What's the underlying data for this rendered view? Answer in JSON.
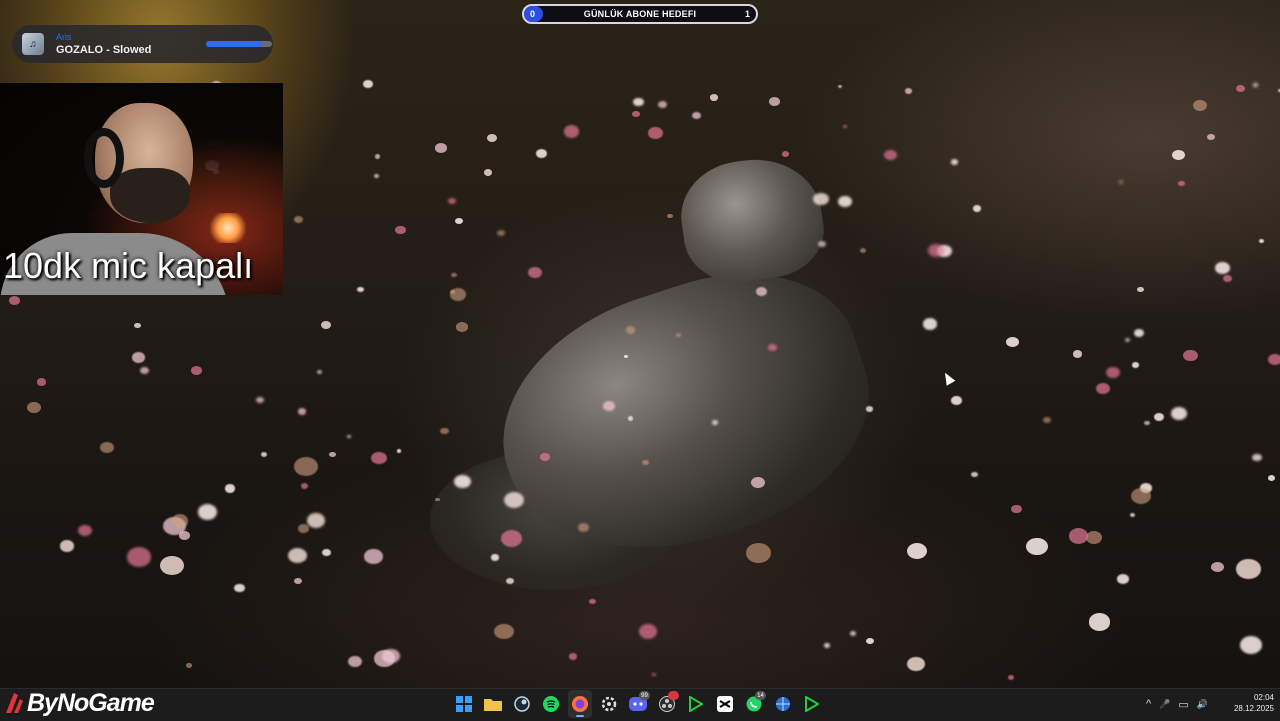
{
  "now_playing": {
    "artist": "Aris",
    "title": "GOZALO - Slowed",
    "progress": 0.85
  },
  "goal": {
    "start": "0",
    "label": "GÜNLÜK ABONE HEDEFI",
    "end": "1",
    "progress": 0.08
  },
  "webcam": {
    "caption": "10dk mic kapalı"
  },
  "brand": {
    "name": "ByNoGame"
  },
  "taskbar": {
    "icons": [
      {
        "name": "windows-start-icon",
        "color": "#3aa0ff"
      },
      {
        "name": "file-explorer-icon",
        "color": "#f2c14e"
      },
      {
        "name": "steam-icon",
        "color": "#c7d5e0"
      },
      {
        "name": "spotify-icon",
        "color": "#1ed760"
      },
      {
        "name": "firefox-icon",
        "color": "#ff7139",
        "active": true
      },
      {
        "name": "settings-gear-icon",
        "color": "#dddddd"
      },
      {
        "name": "discord-icon",
        "color": "#5865f2",
        "badge": "99"
      },
      {
        "name": "obs-icon",
        "color": "#cccccc",
        "badge_red": true
      },
      {
        "name": "app-green-arrow-icon",
        "color": "#27c93f"
      },
      {
        "name": "capcut-icon",
        "color": "#ffffff"
      },
      {
        "name": "whatsapp-icon",
        "color": "#25d366",
        "badge": "14"
      },
      {
        "name": "app-globe-icon",
        "color": "#6fb3ff"
      },
      {
        "name": "app-green-arrow-2-icon",
        "color": "#27c93f"
      }
    ]
  },
  "tray": {
    "chevron": "^",
    "mic": "🎤",
    "network": "▭",
    "volume": "🔊"
  },
  "clock": {
    "time": "02:04",
    "date": "28.12.2025"
  }
}
